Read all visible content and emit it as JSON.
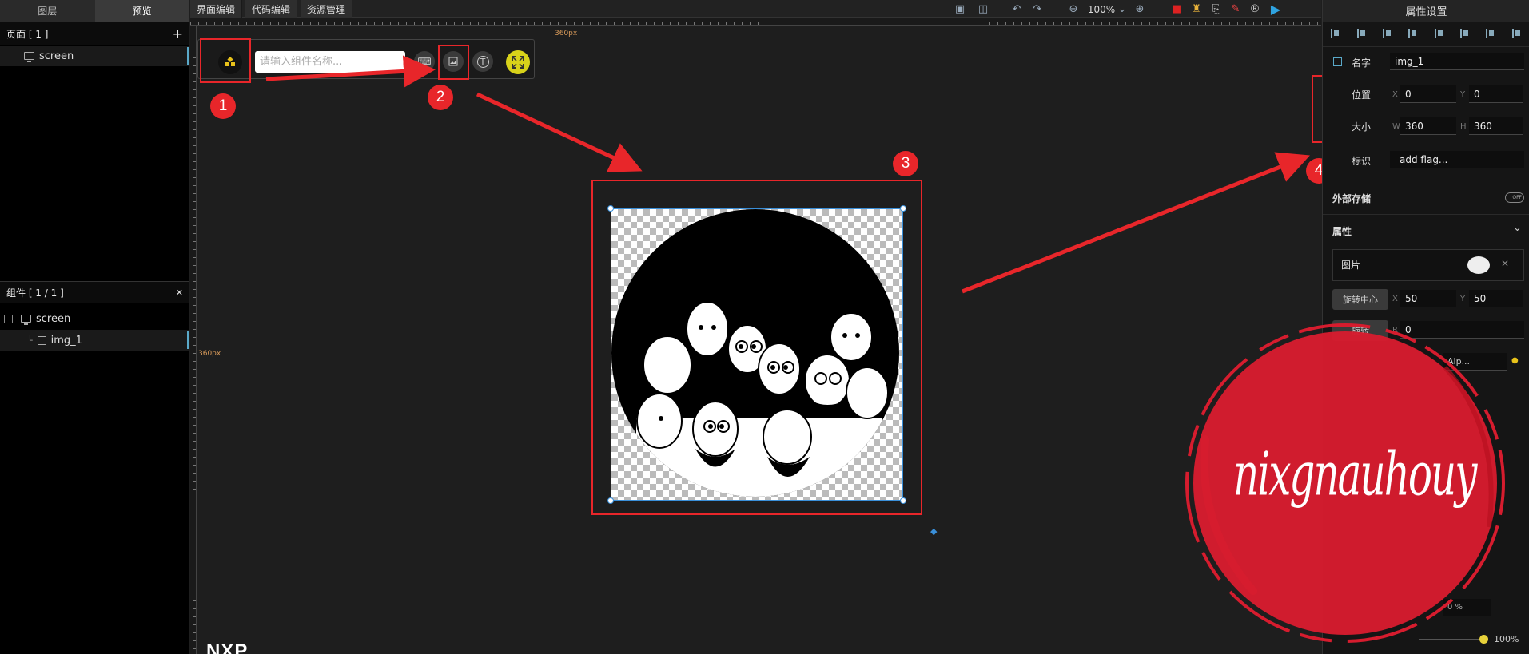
{
  "left_panel": {
    "tabs": [
      "图层",
      "预览"
    ],
    "pages_header": "页面 [ 1 ]",
    "pages_add": "+",
    "pages": [
      {
        "label": "screen"
      }
    ],
    "components_header": "组件 [ 1 / 1 ]",
    "components": [
      {
        "label": "screen"
      },
      {
        "label": "img_1"
      }
    ]
  },
  "top_menu": {
    "items": [
      "界面编辑",
      "代码编辑",
      "资源管理"
    ],
    "zoom": "100%"
  },
  "ruler": {
    "h_label": "360px",
    "v_label": "360px"
  },
  "widget_toolbar": {
    "search_placeholder": "请输入组件名称..."
  },
  "annotations": {
    "badges": [
      "1",
      "2",
      "3",
      "4"
    ]
  },
  "right_panel": {
    "title": "属性设置",
    "name_label": "名字",
    "name_value": "img_1",
    "position_label": "位置",
    "pos_x_axis": "X",
    "pos_x": "0",
    "pos_y_axis": "Y",
    "pos_y": "0",
    "size_label": "大小",
    "size_w_axis": "W",
    "size_w": "360",
    "size_h_axis": "H",
    "size_h": "360",
    "flag_label": "标识",
    "flag_value": "add flag...",
    "external_storage": "外部存储",
    "toggle_text": "OFF",
    "attributes": "属性",
    "image_label": "图片",
    "pivot_label": "旋转中心",
    "pivot_x_axis": "X",
    "pivot_x": "50",
    "pivot_y_axis": "Y",
    "pivot_y": "50",
    "rotate_label": "旋转",
    "rotate_axis": "R",
    "rotate_value": "0",
    "blend_value": "Alp...",
    "opacity_a": "0 %",
    "opacity_b": "100%"
  },
  "watermark": {
    "stamp_text": "nixgnauhouy",
    "logo_text": "NXP"
  },
  "colors": {
    "annotation": "#e8262a",
    "selection": "#3a8fd9",
    "stamp": "#d61c2e"
  }
}
